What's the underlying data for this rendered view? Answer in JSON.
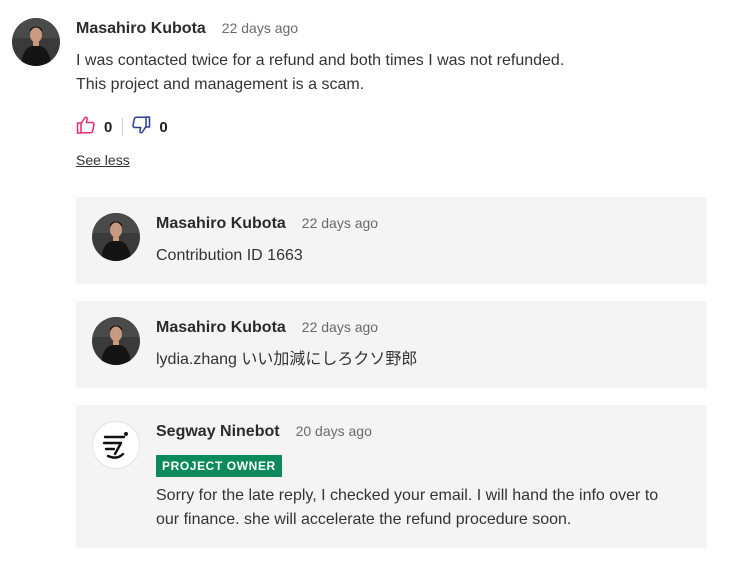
{
  "comment": {
    "author": "Masahiro Kubota",
    "time": "22 days ago",
    "lines": [
      "I was contacted twice for a refund and both times I was not refunded.",
      "This project and management is a scam."
    ],
    "likes": "0",
    "dislikes": "0",
    "see_less": "See less"
  },
  "replies": [
    {
      "author": "Masahiro Kubota",
      "time": "22 days ago",
      "text": "Contribution ID 1663"
    },
    {
      "author": "Masahiro Kubota",
      "time": "22 days ago",
      "text": "lydia.zhang いい加減にしろクソ野郎"
    },
    {
      "author": "Segway Ninebot",
      "time": "20 days ago",
      "badge": "PROJECT OWNER",
      "lines": [
        "Sorry for the late reply, I checked your email. I will hand the info over to",
        "our finance. she will accelerate the refund procedure soon."
      ]
    }
  ],
  "colors": {
    "like_icon": "#e3297a",
    "dislike_icon": "#2a3f8f",
    "owner_badge": "#0c8a5c",
    "reply_bg": "#f4f4f4"
  },
  "icons": {
    "like": "thumbs-up-icon",
    "dislike": "thumbs-down-icon"
  }
}
